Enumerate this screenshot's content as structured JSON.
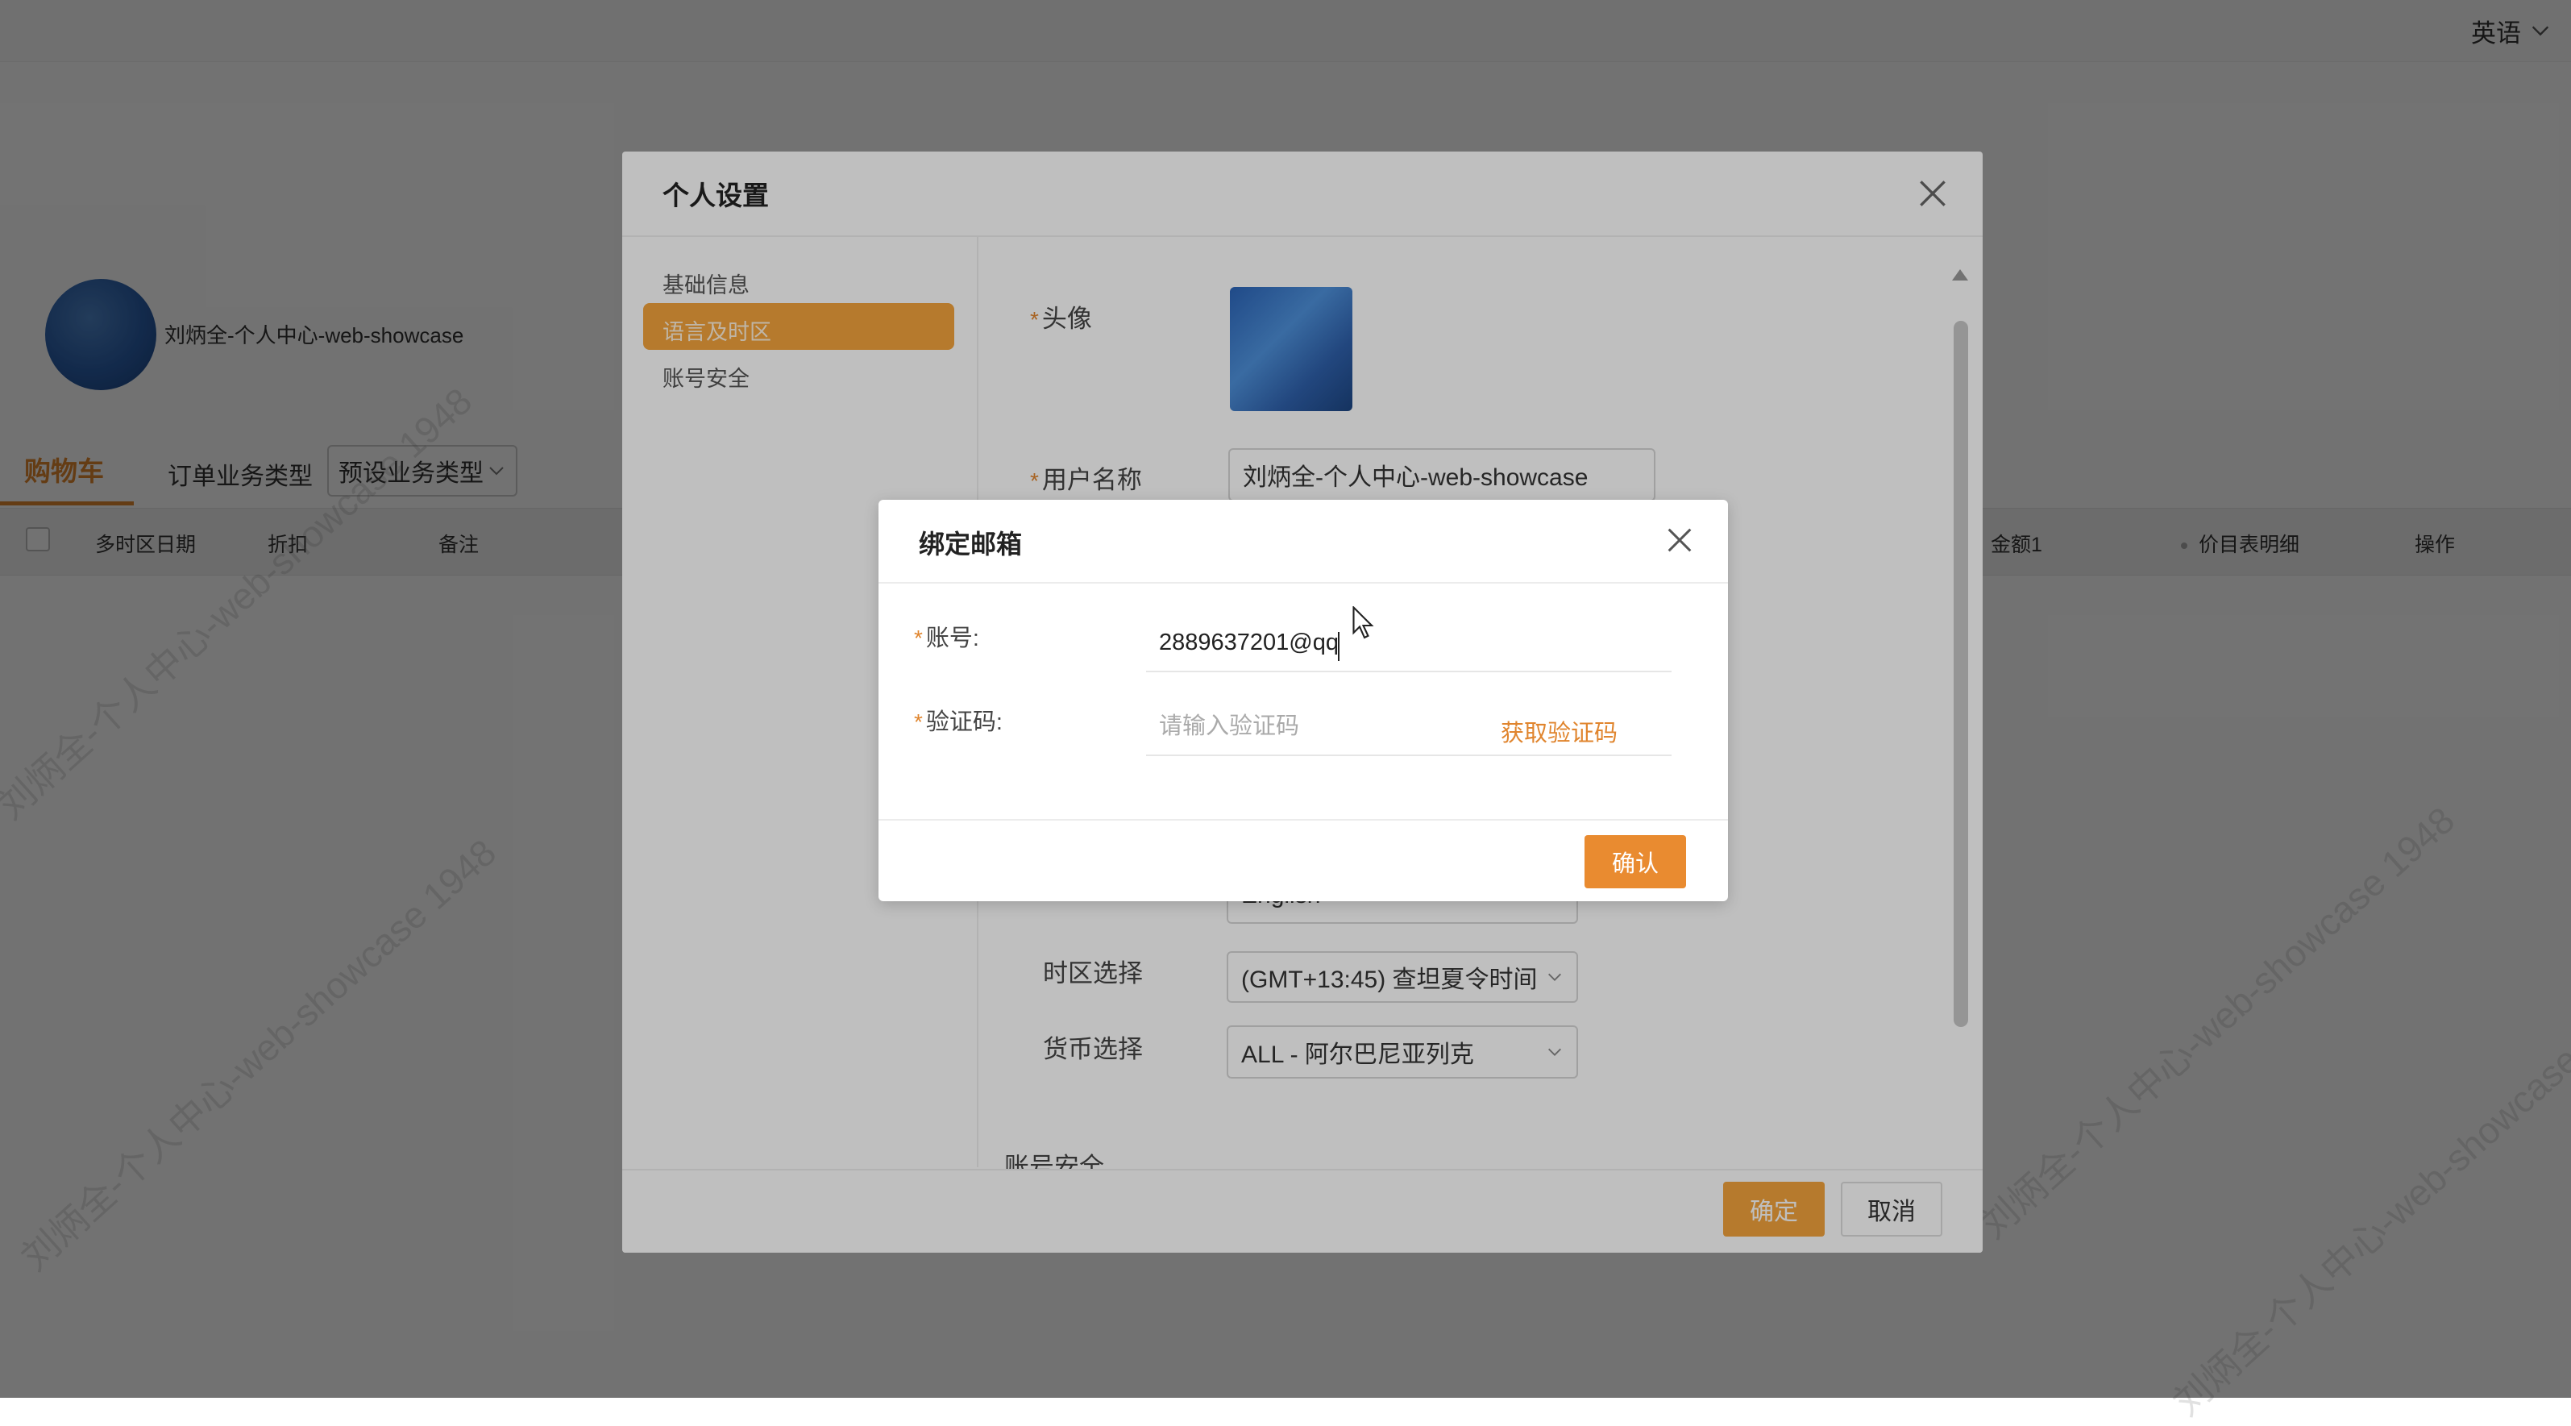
{
  "topbar": {
    "language": "英语"
  },
  "profile": {
    "name": "刘炳全-个人中心-web-showcase"
  },
  "tabs": {
    "cart": "购物车",
    "order_type_label": "订单业务类型",
    "order_type_value": "预设业务类型"
  },
  "table": {
    "headers_left": [
      "多时区日期",
      "折扣",
      "备注"
    ],
    "headers_right": [
      "金额1",
      "价目表明细",
      "操作"
    ]
  },
  "watermark": "刘炳全-个人中心-web-showcase 1948",
  "settings": {
    "title": "个人设置",
    "menu": [
      "基础信息",
      "语言及时区",
      "账号安全"
    ],
    "active_menu": "语言及时区",
    "avatar_label": "头像",
    "username_label": "用户名称",
    "username_value": "刘炳全-个人中心-web-showcase",
    "language_value": "English",
    "timezone_label": "时区选择",
    "timezone_value": "(GMT+13:45) 查坦夏令时间",
    "currency_label": "货币选择",
    "currency_value": "ALL - 阿尔巴尼亚列克",
    "section_account_security": "账号安全",
    "ok_button": "确定",
    "cancel_button": "取消"
  },
  "email_dialog": {
    "title": "绑定邮箱",
    "account_label": "账号:",
    "account_value": "2889637201@qq",
    "code_label": "验证码:",
    "code_placeholder": "请输入验证码",
    "get_code": "获取验证码",
    "confirm": "确认"
  },
  "colors": {
    "accent": "#e98b30",
    "menu_active": "#f3a33c"
  }
}
